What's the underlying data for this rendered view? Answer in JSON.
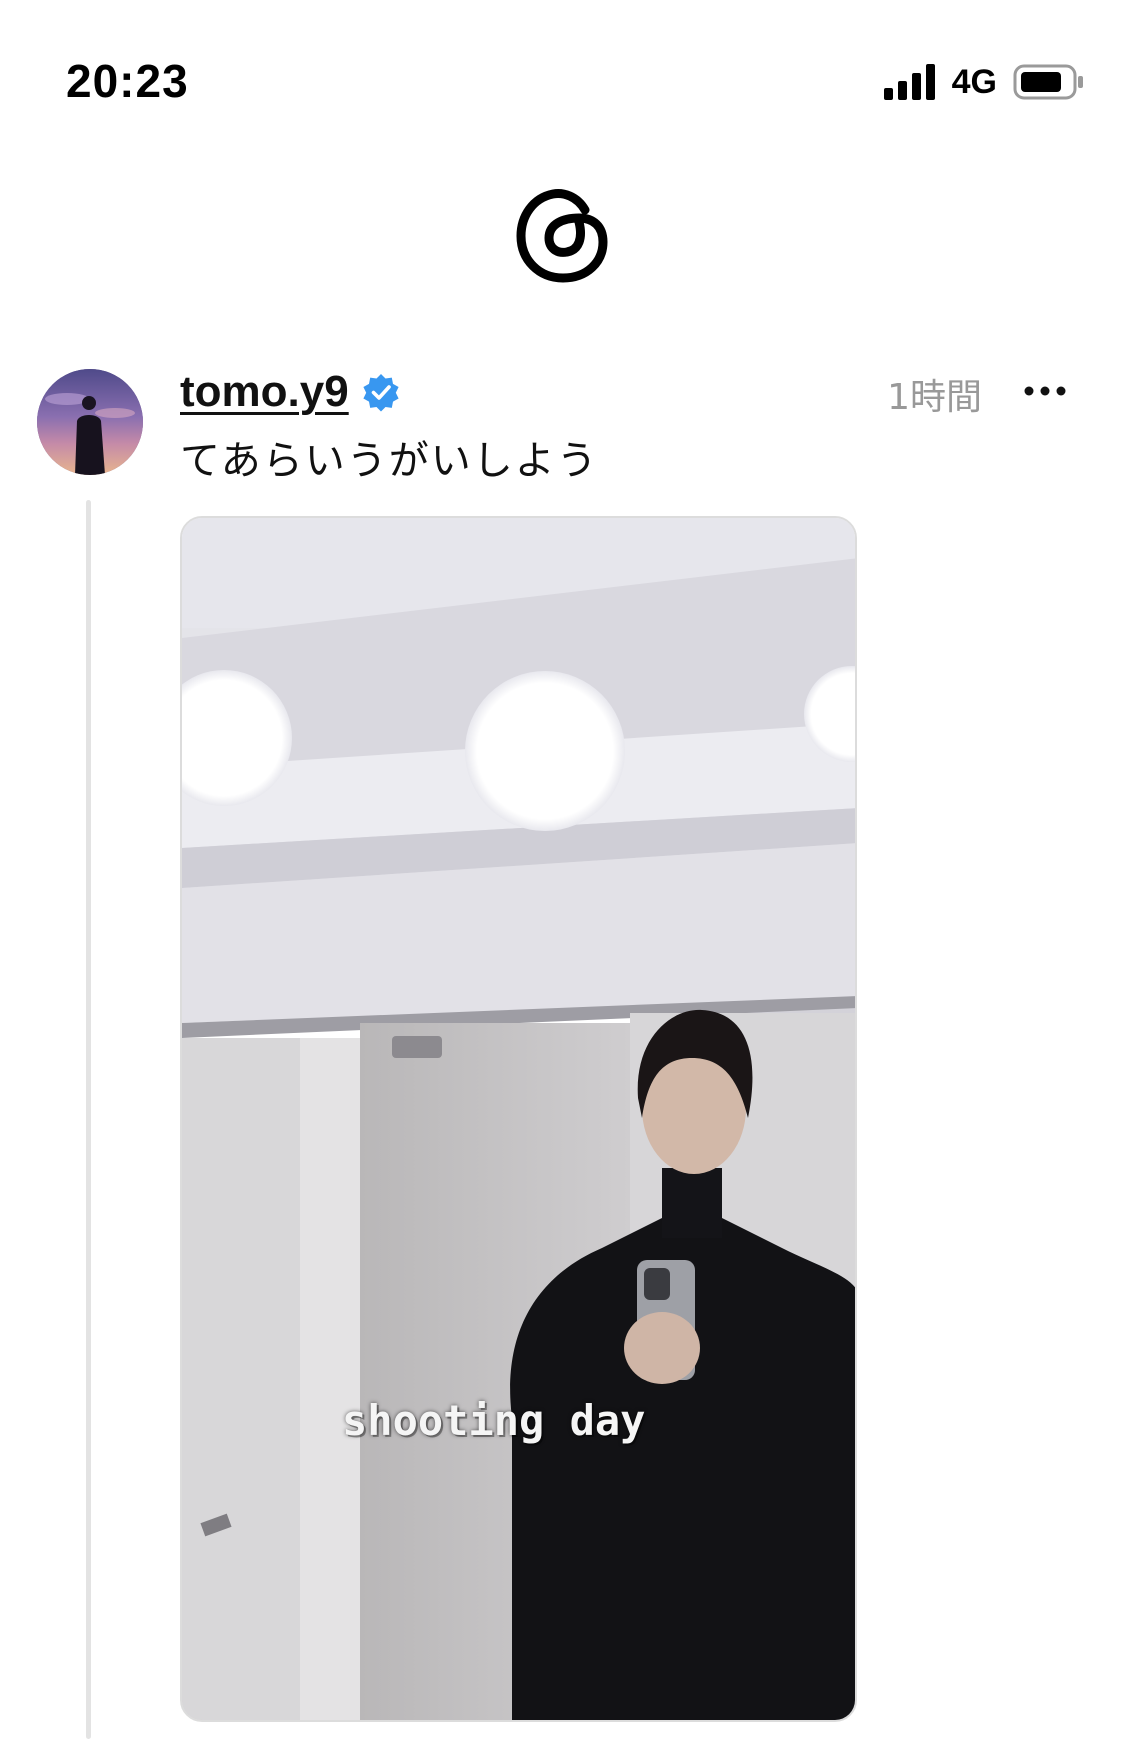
{
  "status_bar": {
    "time": "20:23",
    "network": "4G",
    "icons": [
      "signal-icon",
      "battery-icon"
    ]
  },
  "app": {
    "logo_icon": "threads-logo-icon"
  },
  "post": {
    "username": "tomo.y9",
    "verified": true,
    "verified_color": "#3897f0",
    "time_ago": "1時間",
    "text": "てあらいうがいしよう",
    "more_icon": "more-options-icon",
    "media": {
      "caption": "shooting day"
    }
  }
}
